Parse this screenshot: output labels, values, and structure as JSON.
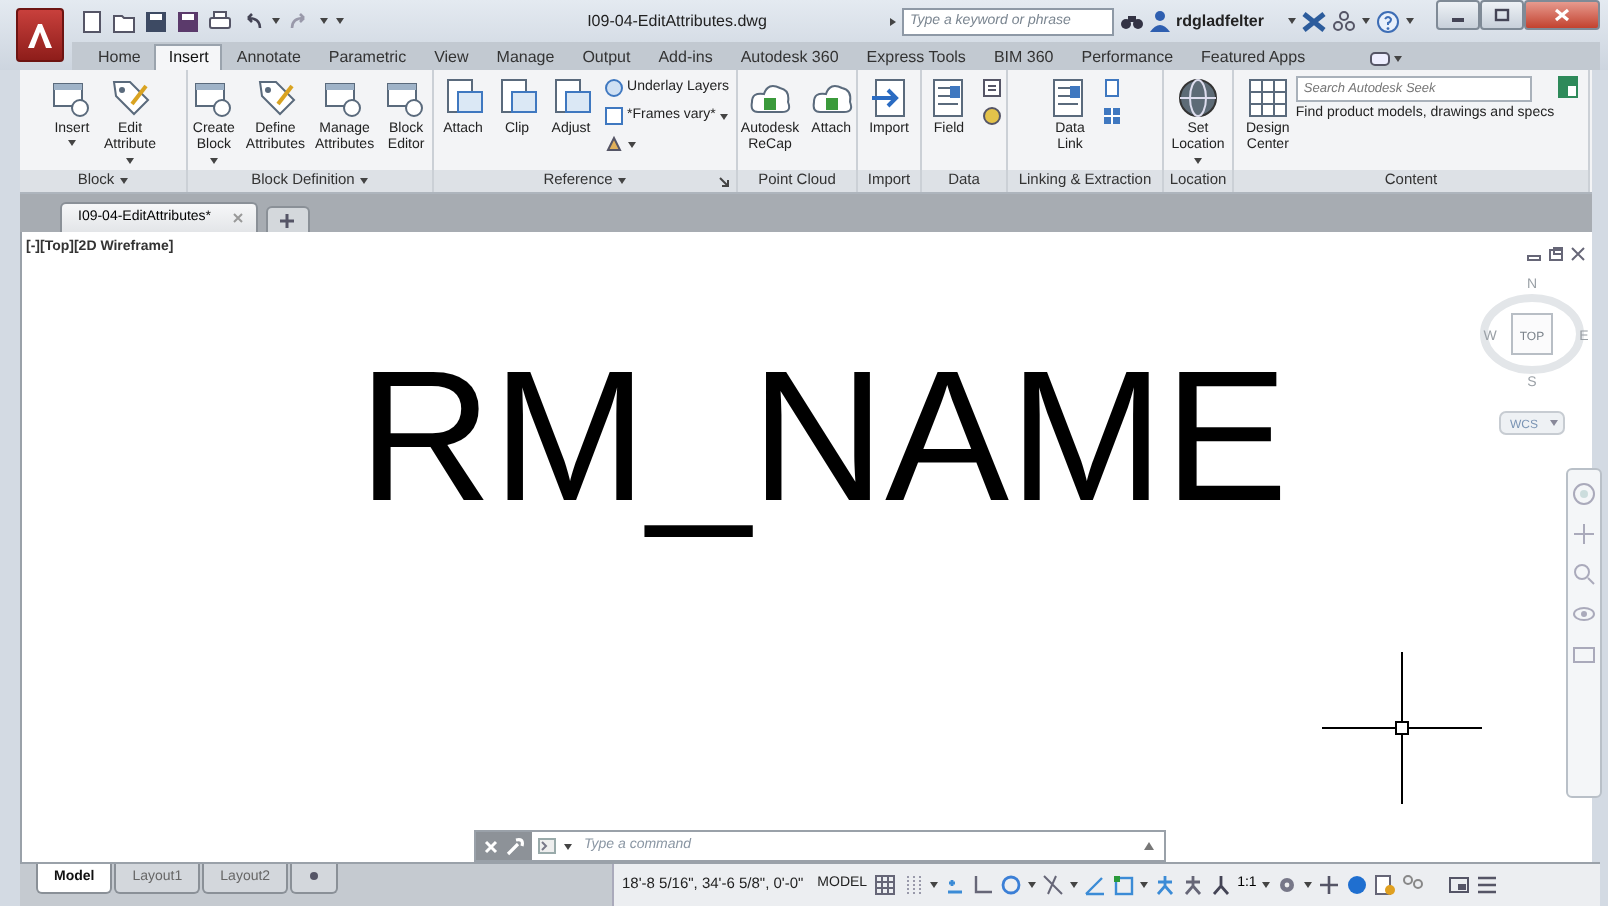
{
  "window": {
    "title": "I09-04-EditAttributes.dwg"
  },
  "search": {
    "placeholder": "Type a keyword or phrase"
  },
  "user": {
    "name": "rdgladfelter"
  },
  "ribbon_tabs": [
    {
      "label": "Home",
      "selected": false
    },
    {
      "label": "Insert",
      "selected": true
    },
    {
      "label": "Annotate",
      "selected": false
    },
    {
      "label": "Parametric",
      "selected": false
    },
    {
      "label": "View",
      "selected": false
    },
    {
      "label": "Manage",
      "selected": false
    },
    {
      "label": "Output",
      "selected": false
    },
    {
      "label": "Add-ins",
      "selected": false
    },
    {
      "label": "Autodesk 360",
      "selected": false
    },
    {
      "label": "Express Tools",
      "selected": false
    },
    {
      "label": "BIM 360",
      "selected": false
    },
    {
      "label": "Performance",
      "selected": false
    },
    {
      "label": "Featured Apps",
      "selected": false
    }
  ],
  "ribbon_panels": [
    {
      "title": "Block",
      "menu": true,
      "launcher": false,
      "items": [
        {
          "kind": "large",
          "label": "Insert",
          "caret": true
        },
        {
          "kind": "large",
          "label": "Edit\nAttribute",
          "caret": true
        }
      ]
    },
    {
      "title": "Block Definition",
      "menu": true,
      "launcher": false,
      "items": [
        {
          "kind": "large",
          "label": "Create\nBlock",
          "caret": true
        },
        {
          "kind": "large",
          "label": "Define\nAttributes",
          "caret": false
        },
        {
          "kind": "large",
          "label": "Manage\nAttributes",
          "caret": false
        },
        {
          "kind": "large",
          "label": "Block\nEditor",
          "caret": false
        }
      ]
    },
    {
      "title": "Reference",
      "menu": true,
      "launcher": true,
      "items": [
        {
          "kind": "large",
          "label": "Attach",
          "caret": false
        },
        {
          "kind": "large",
          "label": "Clip",
          "caret": false
        },
        {
          "kind": "large",
          "label": "Adjust",
          "caret": false
        },
        {
          "kind": "small",
          "label": "Underlay Layers",
          "caret": false
        },
        {
          "kind": "small",
          "label": "*Frames vary*",
          "caret": true
        },
        {
          "kind": "small",
          "caret": true
        }
      ]
    },
    {
      "title": "Point Cloud",
      "menu": false,
      "launcher": false,
      "items": [
        {
          "kind": "large",
          "label": "Autodesk\nReCap",
          "caret": false
        },
        {
          "kind": "large",
          "label": "Attach",
          "caret": false
        }
      ]
    },
    {
      "title": "Import",
      "menu": false,
      "launcher": false,
      "items": [
        {
          "kind": "large",
          "label": "Import",
          "caret": false
        }
      ]
    },
    {
      "title": "Data",
      "menu": false,
      "launcher": false,
      "items": [
        {
          "kind": "large",
          "label": "Field",
          "caret": false
        },
        {
          "kind": "small",
          "caret": false
        },
        {
          "kind": "small",
          "caret": false
        }
      ]
    },
    {
      "title": "Linking & Extraction",
      "menu": false,
      "launcher": false,
      "items": [
        {
          "kind": "large",
          "label": "Data\nLink",
          "caret": false
        },
        {
          "kind": "small",
          "caret": false
        },
        {
          "kind": "small",
          "caret": false
        }
      ]
    },
    {
      "title": "Location",
      "menu": false,
      "launcher": false,
      "items": [
        {
          "kind": "large",
          "label": "Set\nLocation",
          "caret": true
        }
      ]
    },
    {
      "title": "Content",
      "menu": false,
      "launcher": false,
      "items": [
        {
          "kind": "large",
          "label": "Design\nCenter",
          "caret": false
        },
        {
          "kind": "seek",
          "placeholder": "Search Autodesk Seek",
          "text": "Find product models, drawings and specs"
        }
      ]
    }
  ],
  "file_tabs": [
    {
      "label": "I09-04-EditAttributes*",
      "selected": true
    }
  ],
  "viewport": {
    "label": "[-][Top][2D Wireframe]"
  },
  "drawing": {
    "text": "RM_NAME"
  },
  "viewcube": {
    "north": "N",
    "west": "W",
    "top": "TOP",
    "east": "E",
    "south": "S",
    "ucs": "WCS"
  },
  "command_line": {
    "placeholder": "Type a command"
  },
  "layout_tabs": [
    {
      "label": "Model",
      "selected": true
    },
    {
      "label": "Layout1",
      "selected": false
    },
    {
      "label": "Layout2",
      "selected": false
    }
  ],
  "status_bar": {
    "coordinates": "18'-8 5/16\", 34'-6 5/8\", 0'-0\"",
    "space": "MODEL",
    "scale": "1:1"
  }
}
